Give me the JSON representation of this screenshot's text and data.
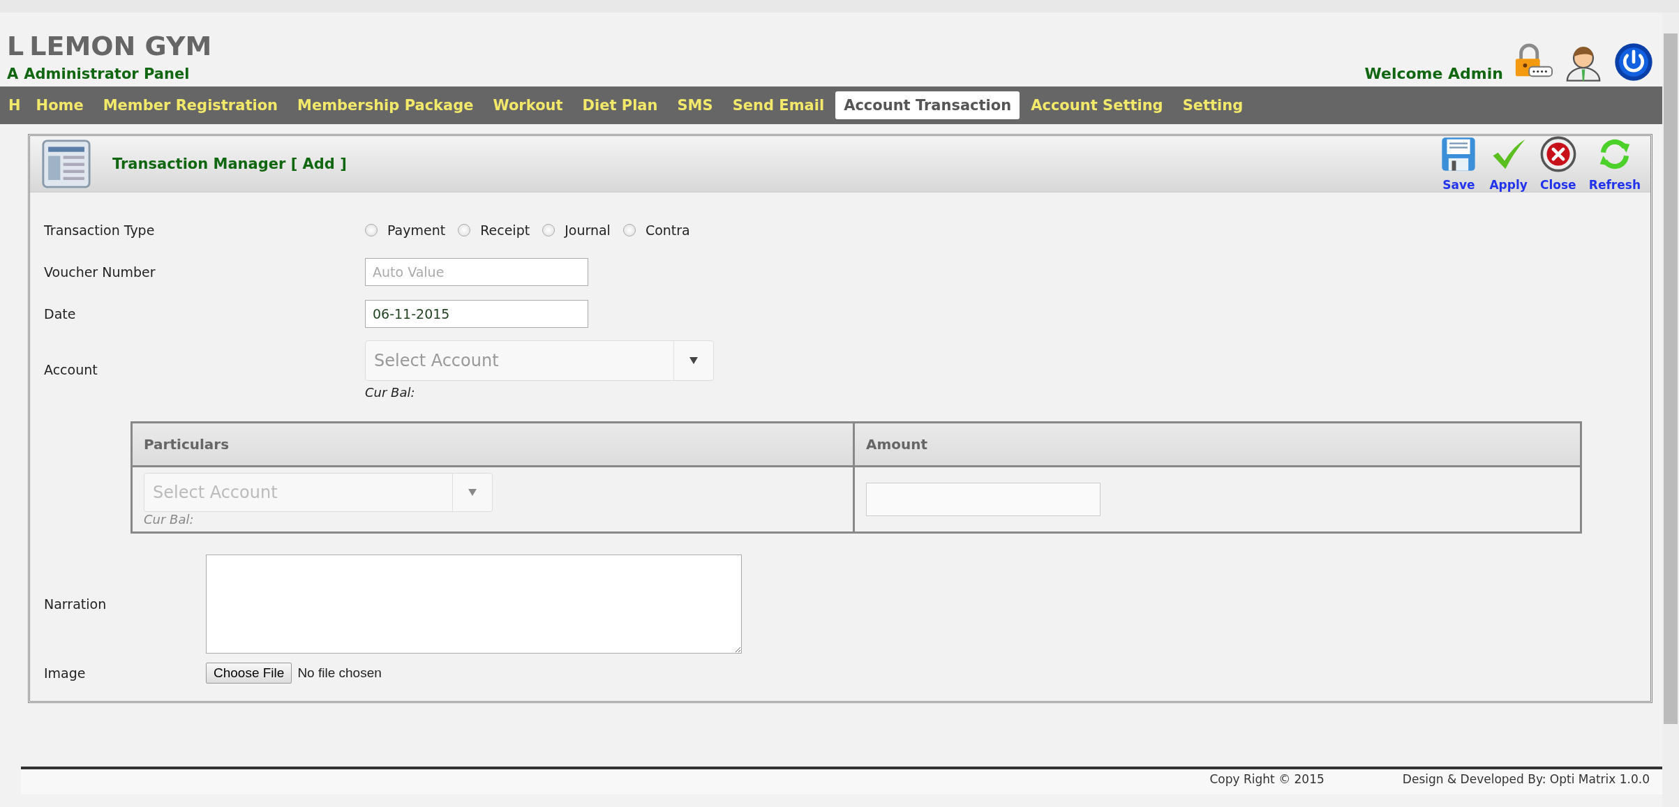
{
  "header": {
    "ghost_title": "L",
    "title": "LEMON GYM",
    "ghost_subtitle": "A",
    "subtitle": "Administrator Panel",
    "welcome": "Welcome Admin"
  },
  "nav": {
    "ghost": "H",
    "items": [
      {
        "label": "Home",
        "selected": false
      },
      {
        "label": "Member Registration",
        "selected": false
      },
      {
        "label": "Membership Package",
        "selected": false
      },
      {
        "label": "Workout",
        "selected": false
      },
      {
        "label": "Diet Plan",
        "selected": false
      },
      {
        "label": "SMS",
        "selected": false
      },
      {
        "label": "Send Email",
        "selected": false
      },
      {
        "label": "Account Transaction",
        "selected": true
      },
      {
        "label": "Account Setting",
        "selected": false
      },
      {
        "label": "Setting",
        "selected": false
      }
    ]
  },
  "panel": {
    "title": "Transaction Manager [ Add ]",
    "actions": [
      {
        "label": "Save",
        "kind": "save"
      },
      {
        "label": "Apply",
        "kind": "apply"
      },
      {
        "label": "Close",
        "kind": "close"
      },
      {
        "label": "Refresh",
        "kind": "refresh"
      }
    ]
  },
  "form": {
    "transaction_type": {
      "label": "Transaction Type",
      "options": [
        {
          "label": "Payment",
          "selected": false
        },
        {
          "label": "Receipt",
          "selected": false
        },
        {
          "label": "Journal",
          "selected": false
        },
        {
          "label": "Contra",
          "selected": false
        }
      ]
    },
    "voucher": {
      "label": "Voucher Number",
      "placeholder": "Auto Value"
    },
    "date": {
      "label": "Date",
      "value": "06-11-2015"
    },
    "account": {
      "label": "Account",
      "placeholder": "Select Account",
      "balance_label": "Cur Bal:"
    }
  },
  "table": {
    "columns": [
      "Particulars",
      "Amount"
    ],
    "rows": [
      {
        "account_placeholder": "Select Account",
        "balance_label": "Cur Bal:"
      }
    ]
  },
  "narration": {
    "label": "Narration"
  },
  "image": {
    "label": "Image",
    "button": "Choose File",
    "status": "No file chosen"
  },
  "footer": {
    "copyright": "Copy Right © 2015",
    "credit": "Design & Developed By: Opti Matrix 1.0.0"
  }
}
